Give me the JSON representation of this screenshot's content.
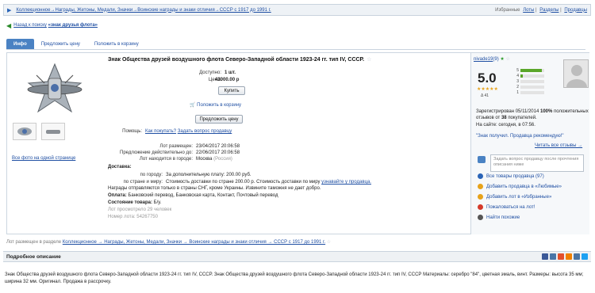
{
  "breadcrumb": {
    "path": "Коллекционное→Награды, Жетоны, Медали, Значки→Воинские награды и знаки отличия→СССР с 1917 до 1991 г.",
    "favorites": "Избранные",
    "lots": "Лоты",
    "sections": "Разделы",
    "sellers": "Продавцы"
  },
  "back": {
    "label": "Назад к поиску",
    "query": "«знак друзья флота»"
  },
  "tabs": [
    "Инфо",
    "Предложить цену",
    "Положить в корзину"
  ],
  "lot": {
    "title": "Знак Общества друзей воздушного флота Северо-Западной области 1923-24 гг. тип IV, СССР.",
    "available_label": "Доступно:",
    "available_value": "1 шт.",
    "price_label": "Цена:",
    "price_value": "43000.00 р",
    "buy_button": "Купить",
    "cart_link": "Положить в корзину",
    "offer_button": "Предложить цену",
    "help_label": "Помощь:",
    "help_how": "Как покупать?",
    "help_ask": "Задать вопрос продавцу",
    "placed_label": "Лот размещен:",
    "placed_value": "23/04/2017 20:06:58",
    "valid_label": "Предложение действительно до:",
    "valid_value": "22/06/2017 20:06:58",
    "city_label": "Лот находится в городе:",
    "city_value": "Москва",
    "city_country": "(Россия)",
    "delivery_title": "Доставка:",
    "delivery_city_label": "по городу:",
    "delivery_city_value": "За дополнительную плату: 200.00 руб.",
    "delivery_country_label": "по стране и миру:",
    "delivery_country_value": "Стоимость доставки по стране 200.00 р.  Стоимость доставки по миру",
    "delivery_country_link": "узнавайте у продавца.",
    "awards_note": "Награды отправляются только в страны СНГ, кроме Украины. Извините таможня не дает добро.",
    "payment_label": "Оплата:",
    "payment_value": "Банковский перевод, Банковская карта, Контакт, Почтовый перевод",
    "condition_label": "Состояние товара:",
    "condition_value": "Б/у.",
    "views": "Лот просмотрело 29 человек",
    "lot_number": "Номер лота: 54267750",
    "all_photos": "Все фото на одной странице"
  },
  "seller": {
    "name": "nivade19",
    "count": "(9)",
    "score": "5.0",
    "stars": "★★★★★",
    "delta": "Δ 41",
    "bars": [
      {
        "n": "5",
        "fill": 0.9
      },
      {
        "n": "4",
        "fill": 0.1
      },
      {
        "n": "3",
        "fill": 0.0
      },
      {
        "n": "2",
        "fill": 0.0
      },
      {
        "n": "1",
        "fill": 0.0
      }
    ],
    "registered": "Зарегистрирован 05/11/2014",
    "positive_pct": "100%",
    "positive_text": "положительных отзывов от",
    "buyers_count": "38",
    "buyers_text": "покупателей.",
    "online_label": "На сайте:",
    "online_value": "сегодня, в 07:56.",
    "check_link": "\"Знак получил. Продавца рекомендую!\"",
    "read_all": "Читать все отзывы →",
    "ask_placeholder": "Задать вопрос продавцу после прочтения описания ниже",
    "links": [
      {
        "label": "Все товары продавца",
        "extra": "(97)",
        "color": "#2a64b7"
      },
      {
        "label": "Добавить продавца в «Любимые»",
        "extra": "",
        "color": "#e7a21a"
      },
      {
        "label": "Добавить лот в «Избранные»",
        "extra": "",
        "color": "#e7a21a"
      },
      {
        "label": "Пожаловаться на лот!",
        "extra": "",
        "color": "#d43a2a"
      },
      {
        "label": "Найти похожие",
        "extra": "",
        "color": "#555555"
      }
    ]
  },
  "bottom_crumb": {
    "label": "Лот размещен в разделе",
    "path": "Коллекционное → Награды, Жетоны, Медали, Значки → Воинские награды и знаки отличия → СССР с 1917 до 1991 г."
  },
  "description": {
    "header": "Подробное описание",
    "text": "Знак Общества друзей воздушного флота Северо-Западной области 1923-24 гг. тип IV, СССР. Знак Общества друзей воздушного флота Северо-Западной области 1923-24 гг. тип IV, СССР Материалы: серебро \"84\", цветная эмаль, винт. Размеры: высота 35 мм; ширина 32 мм. Оригинал. Продажа в рассрочку."
  },
  "social_colors": [
    "#3b5998",
    "#4a76a8",
    "#e3502c",
    "#f08000",
    "#4c75a3",
    "#1da1f2"
  ]
}
